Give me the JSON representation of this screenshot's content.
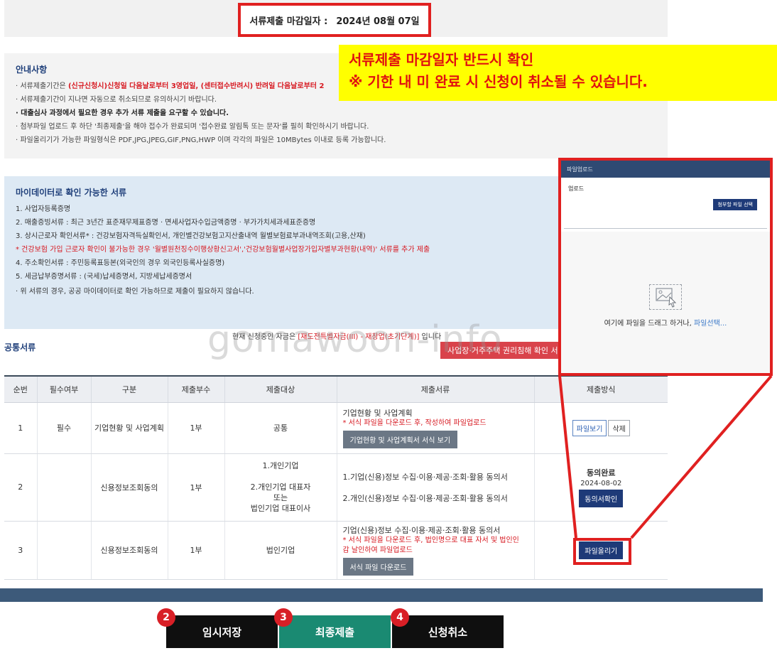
{
  "deadline": {
    "label": "서류제출 마감일자 :",
    "date": "2024년 08월 07일"
  },
  "callout": {
    "line1": "서류제출 마감일자 반드시 확인",
    "line2": "※ 기한 내 미 완료 시 신청이 취소될 수 있습니다."
  },
  "notice": {
    "title": "안내사항",
    "items": [
      {
        "prefix": "· 서류제출기간은 ",
        "red": "(신규신청시)신청일 다음날로부터 3영업일, (센터접수반려시) 반려일 다음날로부터 2",
        "rest": ""
      },
      {
        "prefix": "· 서류제출기간이 지나면 자동으로 취소되므로 유의하시기 바랍니다.",
        "red": "",
        "rest": ""
      },
      {
        "prefix": "· 대출심사 과정에서 필요한 경우 추가 서류 제출을 요구할 수 있습니다.",
        "red": "",
        "rest": ""
      },
      {
        "prefix": "· 첨부파일 업로드 후 하단 '최종제출'을 해야 접수가 완료되며 '접수완료 알림톡 또는 문자'를 필히 확인하시기 바랍니다.",
        "red": "",
        "rest": ""
      },
      {
        "prefix": "· 파일올리기가 가능한 파일형식은 PDF,JPG,JPEG,GIF,PNG,HWP 이며 각각의 파일은 10MBytes 이내로 등록 가능합니다.",
        "red": "",
        "rest": ""
      }
    ]
  },
  "mydata": {
    "title": "마이데이터로 확인 가능한 서류",
    "lines": [
      "1. 사업자등록증명",
      "2. 매출증빙서류 : 최근 3년간 표준재무제표증명 · 면세사업자수입금액증명 · 부가가치세과세표준증명",
      "3. 상시근로자 확인서류* : 건강보험자격득실확인서, 개인별건강보험고지산출내역 월별보험료부과내역조회(고용,산재)",
      "* 건강보험 가입 근로자 확인이 불가능한 경우 '월별원천징수이행상황신고서','건강보험월별사업장가입자별부과현황(내역)' 서류를 추가 제출",
      "4. 주소확인서류 : 주민등록표등본(외국인의 경우 외국인등록사실증명)",
      "5. 세금납부증명서류 : (국세)납세증명서, 지방세납세증명서",
      "· 위 서류의 경우, 공공 마이데이터로 확인 가능하므로 제출이 필요하지 않습니다."
    ]
  },
  "current": {
    "prefix": "현재 신청중인 자금은 ",
    "fund": "[재도전특별자금(III) - 재창업(초기단계)]",
    "suffix": " 입니다"
  },
  "common_docs_title": "공통서류",
  "watermark": "gomawoon-info",
  "housing_button": "사업장·거주주택 권리침해 확인 서",
  "table": {
    "headers": [
      "순번",
      "필수여부",
      "구분",
      "제출부수",
      "제출대상",
      "제출서류",
      "제출방식"
    ],
    "rows": [
      {
        "no": "1",
        "required": "필수",
        "category": "기업현황 및 사업계획",
        "copies": "1부",
        "target": "공통",
        "doc_title": "기업현황 및 사업계획",
        "doc_note": "* 서식 파일을 다운로드 후, 작성하여 파일업로드",
        "doc_button": "기업현황 및 사업계획서 서식 보기",
        "view_button": "파일보기",
        "delete_button": "삭제"
      },
      {
        "no": "2",
        "required": "",
        "category": "신용정보조회동의",
        "copies": "1부",
        "target1": "1.개인기업",
        "target2": "2.개인기업 대표자",
        "target3": "또는",
        "target4": "법인기업 대표이사",
        "doc_line1": "1.기업(신용)정보 수집·이용·제공·조회·활용 동의서",
        "doc_line2": "2.개인(신용)정보 수집·이용·제공·조회·활용 동의서",
        "status": "동의완료",
        "date": "2024-08-02",
        "confirm_button": "동의서확인"
      },
      {
        "no": "3",
        "required": "",
        "category": "신용정보조회동의",
        "copies": "1부",
        "target": "법인기업",
        "doc_title": "기업(신용)정보 수집·이용·제공·조회·활용 동의서",
        "doc_note1": "* 서식 파일을 다운로드 후, 법인명으로 대표 자서 및 법인인",
        "doc_note2": "감 날인하여 파일업로드",
        "doc_button": "서식 파일 다운로드",
        "upload_button": "파일올리기"
      }
    ]
  },
  "actions": [
    {
      "step": "2",
      "label": "임시저장"
    },
    {
      "step": "3",
      "label": "최종제출"
    },
    {
      "step": "4",
      "label": "신청취소"
    }
  ],
  "modal": {
    "title": "파일업로드",
    "upload_label": "업로드",
    "select_button": "첨부할 파일 선택",
    "drop_text": "여기에 파일을 드래그 하거나, ",
    "drop_link": "파일선택..."
  },
  "colors": {
    "highlight_red": "#e02020",
    "callout_yellow": "#ffff00",
    "navy": "#1e3a78",
    "green": "#1a8a72"
  }
}
